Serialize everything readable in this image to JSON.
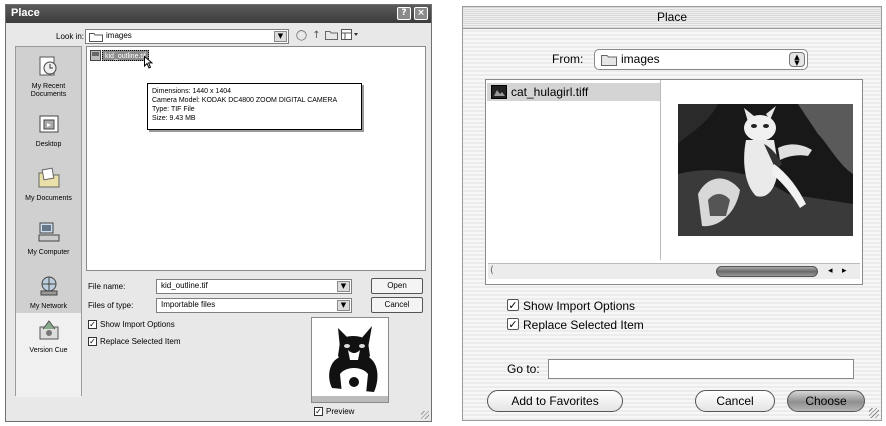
{
  "win_dialog": {
    "title": "Place",
    "title_buttons": [
      "?",
      "×"
    ],
    "look_in": {
      "label": "Look in:",
      "value": "images"
    },
    "places": [
      {
        "label": "My Recent Documents",
        "icon": "recent-documents-icon"
      },
      {
        "label": "Desktop",
        "icon": "desktop-icon"
      },
      {
        "label": "My Documents",
        "icon": "my-documents-icon"
      },
      {
        "label": "My Computer",
        "icon": "my-computer-icon"
      },
      {
        "label": "My Network",
        "icon": "my-network-icon"
      },
      {
        "label": "Version Cue",
        "icon": "version-cue-icon"
      }
    ],
    "file": {
      "name": "kid_outline.tif"
    },
    "tooltip": {
      "dimensions": "Dimensions: 1440 x 1404",
      "camera": "Camera Model: KODAK DC4800 ZOOM DIGITAL CAMERA",
      "type": "Type: TIF File",
      "size": "Size: 9.43 MB"
    },
    "file_name": {
      "label": "File name:",
      "value": "kid_outline.tif"
    },
    "files_of_type": {
      "label": "Files of type:",
      "value": "Importable files"
    },
    "open_label": "Open",
    "cancel_label": "Cancel",
    "show_import_options": {
      "label": "Show Import Options",
      "checked": true
    },
    "replace_selected_item": {
      "label": "Replace Selected Item",
      "checked": true
    },
    "preview": {
      "label": "Preview",
      "checked": true
    }
  },
  "mac_dialog": {
    "title": "Place",
    "from": {
      "label": "From:",
      "value": "images"
    },
    "file": {
      "name": "cat_hulagirl.tiff"
    },
    "show_import_options": {
      "label": "Show Import Options",
      "checked": true
    },
    "replace_selected_item": {
      "label": "Replace Selected Item",
      "checked": true
    },
    "go_to": {
      "label": "Go to:",
      "value": ""
    },
    "add_to_favorites_label": "Add to Favorites",
    "cancel_label": "Cancel",
    "choose_label": "Choose"
  }
}
